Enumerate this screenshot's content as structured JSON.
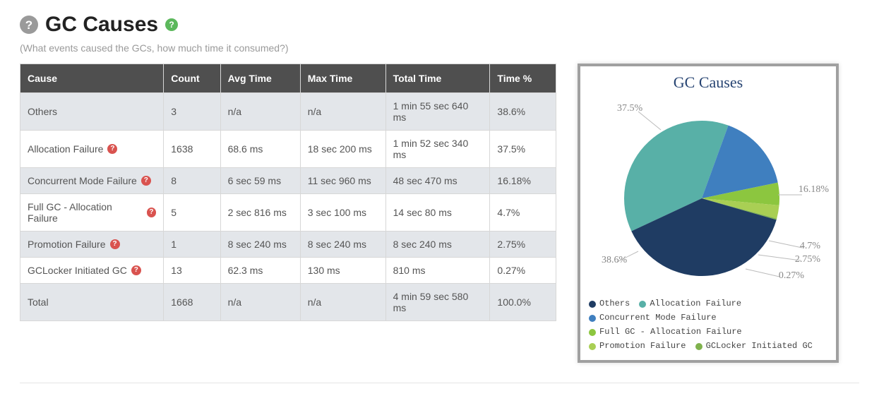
{
  "header": {
    "title": "GC Causes",
    "subtitle": "(What events caused the GCs, how much time it consumed?)"
  },
  "table": {
    "headers": {
      "cause": "Cause",
      "count": "Count",
      "avg": "Avg Time",
      "max": "Max Time",
      "total": "Total Time",
      "pct": "Time %"
    },
    "rows": [
      {
        "cause": "Others",
        "help": false,
        "count": "3",
        "avg": "n/a",
        "max": "n/a",
        "total": "1 min 55 sec 640 ms",
        "pct": "38.6%"
      },
      {
        "cause": "Allocation Failure",
        "help": true,
        "count": "1638",
        "avg": "68.6 ms",
        "max": "18 sec 200 ms",
        "total": "1 min 52 sec 340 ms",
        "pct": "37.5%"
      },
      {
        "cause": "Concurrent Mode Failure",
        "help": true,
        "count": "8",
        "avg": "6 sec 59 ms",
        "max": "11 sec 960 ms",
        "total": "48 sec 470 ms",
        "pct": "16.18%"
      },
      {
        "cause": "Full GC - Allocation Failure",
        "help": true,
        "count": "5",
        "avg": "2 sec 816 ms",
        "max": "3 sec 100 ms",
        "total": "14 sec 80 ms",
        "pct": "4.7%"
      },
      {
        "cause": "Promotion Failure",
        "help": true,
        "count": "1",
        "avg": "8 sec 240 ms",
        "max": "8 sec 240 ms",
        "total": "8 sec 240 ms",
        "pct": "2.75%"
      },
      {
        "cause": "GCLocker Initiated GC",
        "help": true,
        "count": "13",
        "avg": "62.3 ms",
        "max": "130 ms",
        "total": "810 ms",
        "pct": "0.27%"
      },
      {
        "cause": "Total",
        "help": false,
        "count": "1668",
        "avg": "n/a",
        "max": "n/a",
        "total": "4 min 59 sec 580 ms",
        "pct": "100.0%"
      }
    ]
  },
  "chart": {
    "title": "GC Causes",
    "labels": {
      "others": "38.6%",
      "alloc": "37.5%",
      "conc": "16.18%",
      "fullgc": "4.7%",
      "promo": "2.75%",
      "gclock": "0.27%"
    },
    "colors": {
      "others": "#1f3c63",
      "alloc": "#58b0a7",
      "conc": "#3f7fbf",
      "fullgc": "#8cc63f",
      "promo": "#a9cf54",
      "gclock": "#7fb24d"
    },
    "legend": {
      "others": "Others",
      "alloc": "Allocation Failure",
      "conc": "Concurrent Mode Failure",
      "fullgc": "Full GC - Allocation Failure",
      "promo": "Promotion Failure",
      "gclock": "GCLocker Initiated GC"
    }
  },
  "chart_data": {
    "type": "pie",
    "title": "GC Causes",
    "series": [
      {
        "name": "Others",
        "value": 38.6,
        "color": "#1f3c63"
      },
      {
        "name": "Allocation Failure",
        "value": 37.5,
        "color": "#58b0a7"
      },
      {
        "name": "Concurrent Mode Failure",
        "value": 16.18,
        "color": "#3f7fbf"
      },
      {
        "name": "Full GC - Allocation Failure",
        "value": 4.7,
        "color": "#8cc63f"
      },
      {
        "name": "Promotion Failure",
        "value": 2.75,
        "color": "#a9cf54"
      },
      {
        "name": "GCLocker Initiated GC",
        "value": 0.27,
        "color": "#7fb24d"
      }
    ]
  }
}
